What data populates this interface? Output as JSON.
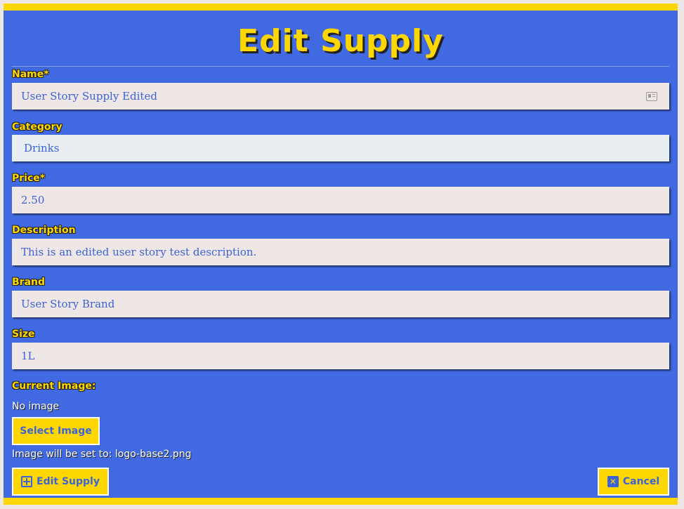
{
  "page": {
    "title": "Edit Supply"
  },
  "form": {
    "name": {
      "label": "Name*",
      "value": "User Story Supply Edited",
      "icon": "contact-card-icon"
    },
    "category": {
      "label": "Category",
      "value": "Drinks"
    },
    "price": {
      "label": "Price*",
      "value": "2.50"
    },
    "description": {
      "label": "Description",
      "value": "This is an edited user story test description."
    },
    "brand": {
      "label": "Brand",
      "value": "User Story Brand"
    },
    "size": {
      "label": "Size",
      "value": "1L"
    },
    "image": {
      "label": "Current Image:",
      "current": "No image",
      "select_label": "Select Image",
      "note": "Image will be set to: logo-base2.png"
    }
  },
  "actions": {
    "submit_label": "Edit Supply",
    "submit_icon": "plus-square-icon",
    "cancel_label": "Cancel",
    "cancel_icon": "x-square-icon"
  },
  "colors": {
    "background": "#4169e1",
    "accent": "#ffd700",
    "field": "#efe6e6",
    "field_text": "#3b63d6"
  }
}
